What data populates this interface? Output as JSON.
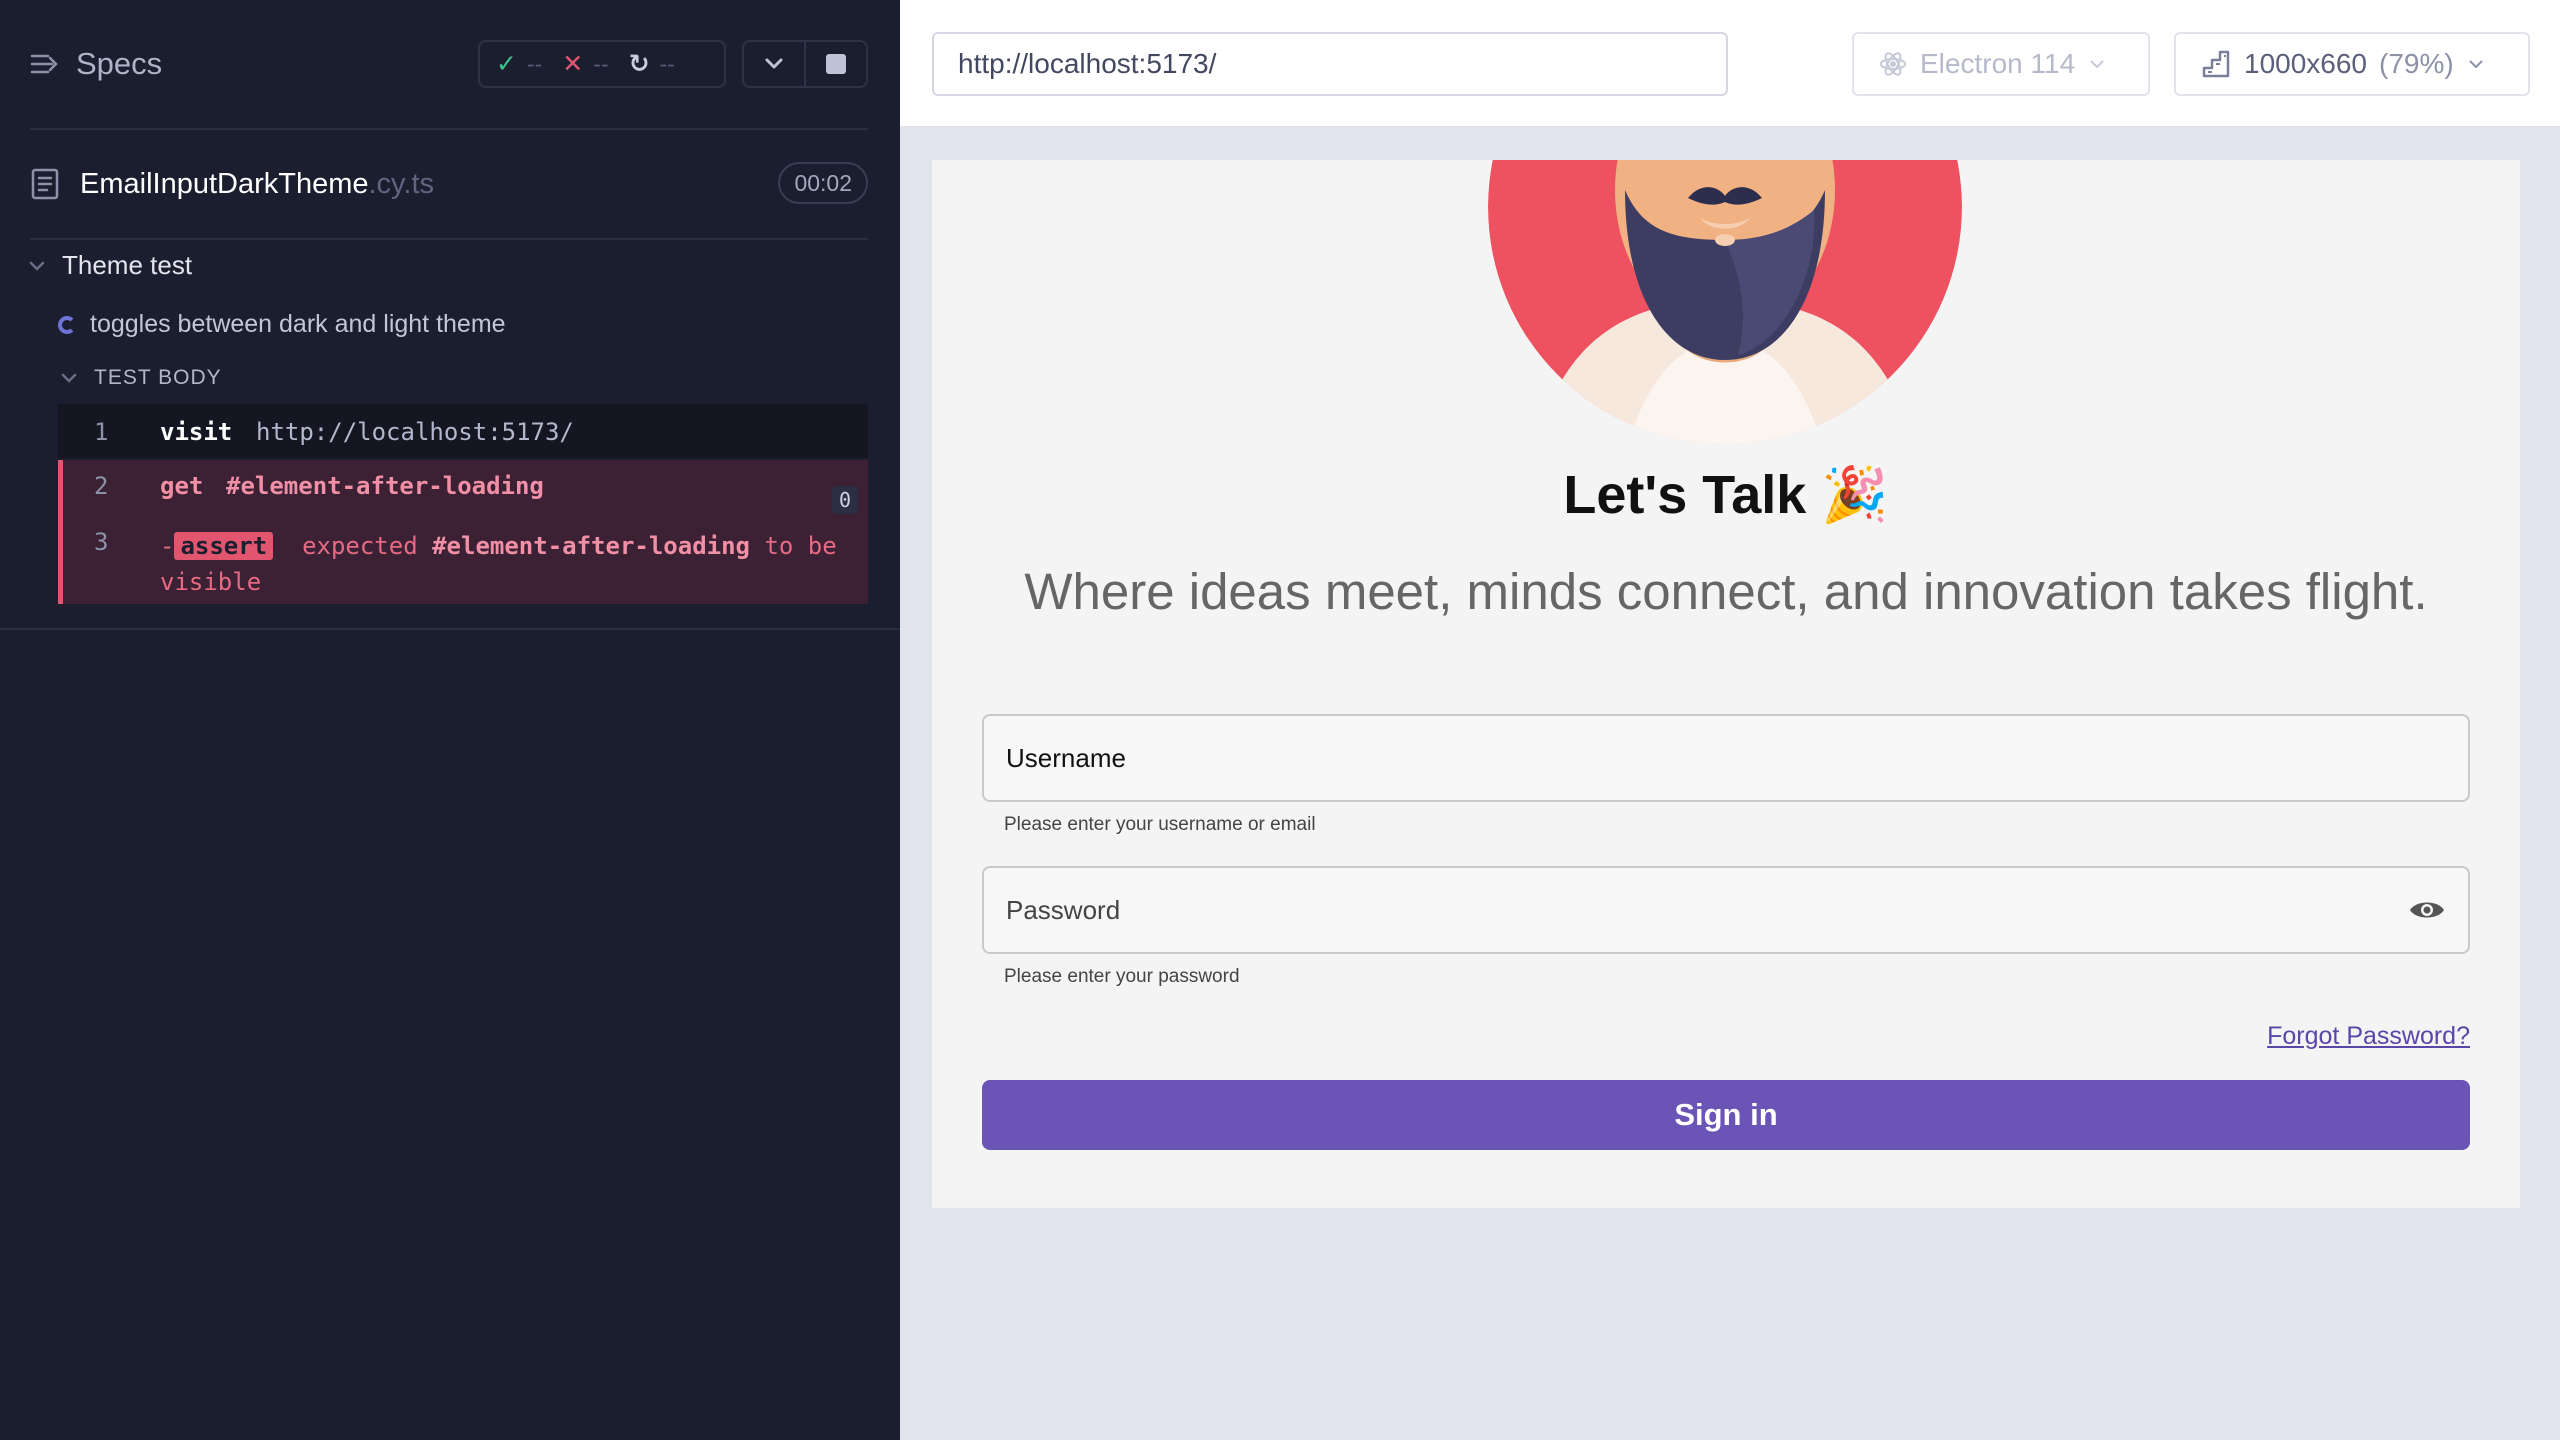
{
  "reporter": {
    "specs_label": "Specs",
    "stats": {
      "passed": "--",
      "failed": "--",
      "pending": "--"
    },
    "spec": {
      "name": "EmailInputDarkTheme",
      "ext": ".cy.ts",
      "duration": "00:02"
    },
    "suite": "Theme test",
    "test": "toggles between dark and light theme",
    "test_body_label": "TEST BODY",
    "commands": [
      {
        "num": "1",
        "name": "visit",
        "arg": "http://localhost:5173/"
      },
      {
        "num": "2",
        "name": "get",
        "arg": "#element-after-loading",
        "badge": "0"
      },
      {
        "num": "3",
        "prefix": "-",
        "name": "assert",
        "text_pre": "expected",
        "selector": "#element-after-loading",
        "text_post": "to be visible"
      }
    ]
  },
  "aut_header": {
    "url": "http://localhost:5173/",
    "browser": "Electron 114",
    "viewport": "1000x660",
    "scale": "(79%)"
  },
  "app": {
    "headline": "Let's Talk 🎉",
    "subline": "Where ideas meet, minds connect, and innovation takes flight.",
    "username_label": "Username",
    "username_helper": "Please enter your username or email",
    "password_label": "Password",
    "password_helper": "Please enter your password",
    "forgot_link": "Forgot Password?",
    "signin_label": "Sign in"
  },
  "colors": {
    "reporter_bg": "#1b1e2e",
    "failed_accent": "#e1556f",
    "signin_button": "#6a55b7",
    "avatar_bg": "#ee5160"
  }
}
